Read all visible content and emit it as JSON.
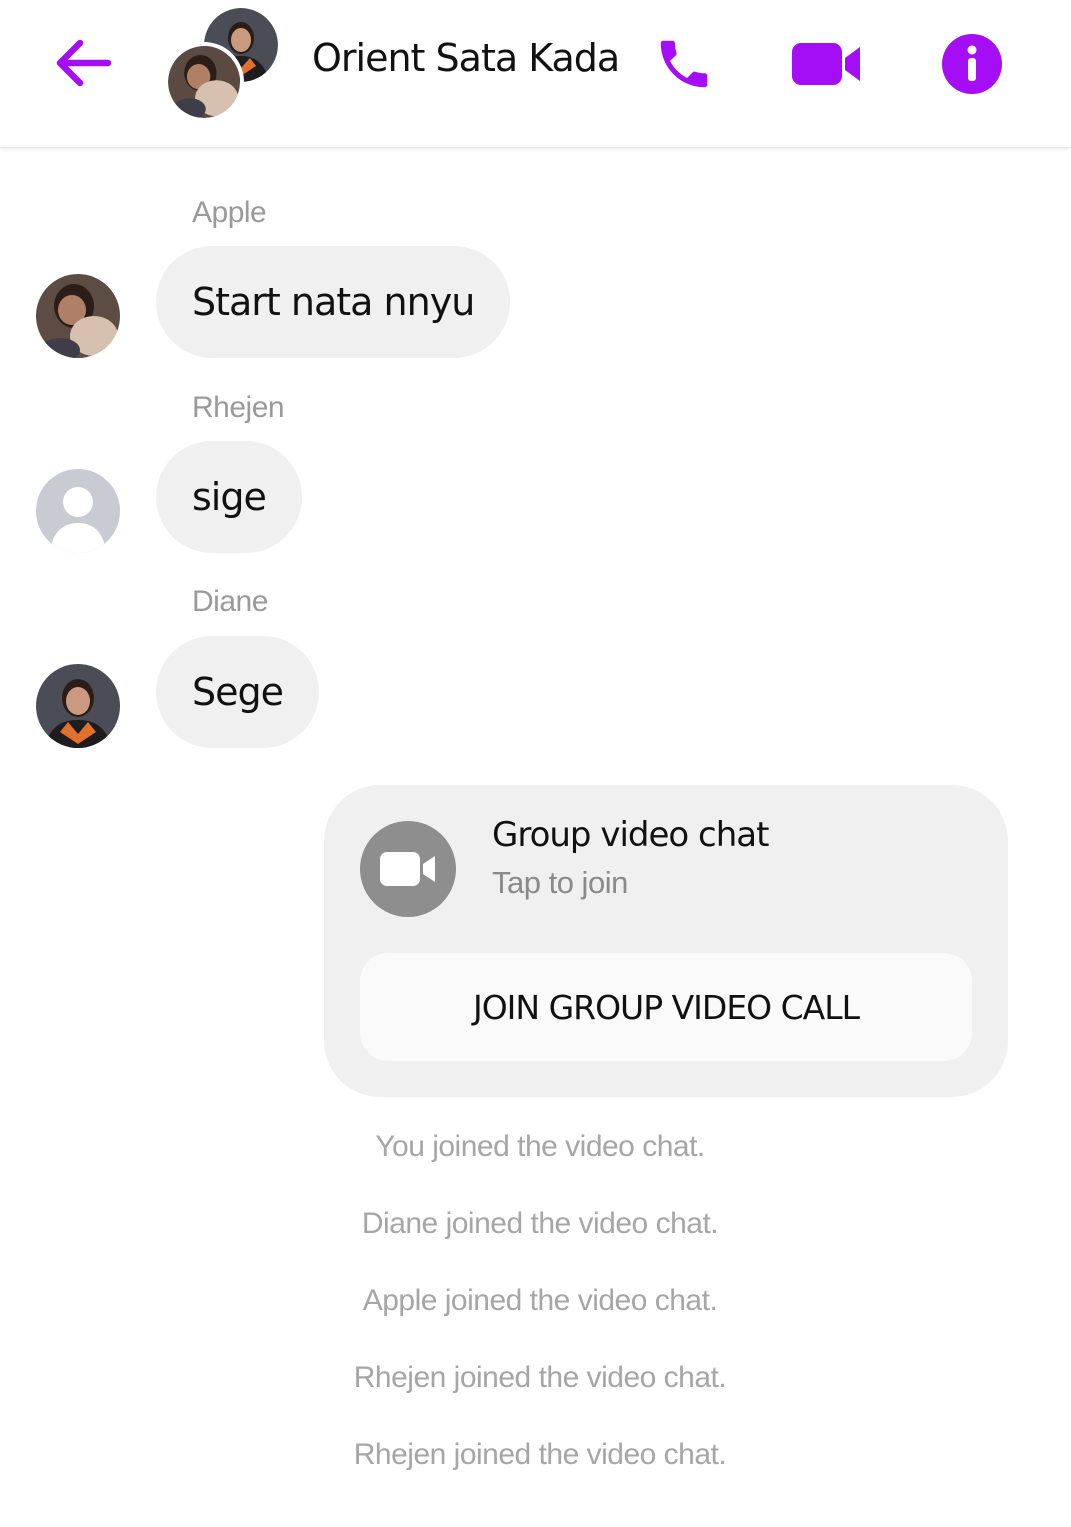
{
  "header": {
    "title": "Orient Sata Kada...",
    "accent_color": "#a40df5",
    "back_icon": "arrow-left-icon",
    "call_icon": "phone-icon",
    "video_icon": "video-camera-icon",
    "info_icon": "info-icon"
  },
  "messages": [
    {
      "sender": "Apple",
      "text": "Start nata nnyu",
      "avatar": "photo"
    },
    {
      "sender": "Rhejen",
      "text": "sige",
      "avatar": "default-person"
    },
    {
      "sender": "Diane",
      "text": "Sege",
      "avatar": "photo"
    }
  ],
  "video_chat": {
    "title": "Group video chat",
    "subtitle": "Tap to join",
    "button_label": "JOIN GROUP VIDEO CALL",
    "icon": "video-camera-icon"
  },
  "events": [
    "You joined the video chat.",
    "Diane joined the video chat.",
    "Apple joined the video chat.",
    "Rhejen joined the video chat.",
    "Rhejen joined the video chat."
  ]
}
